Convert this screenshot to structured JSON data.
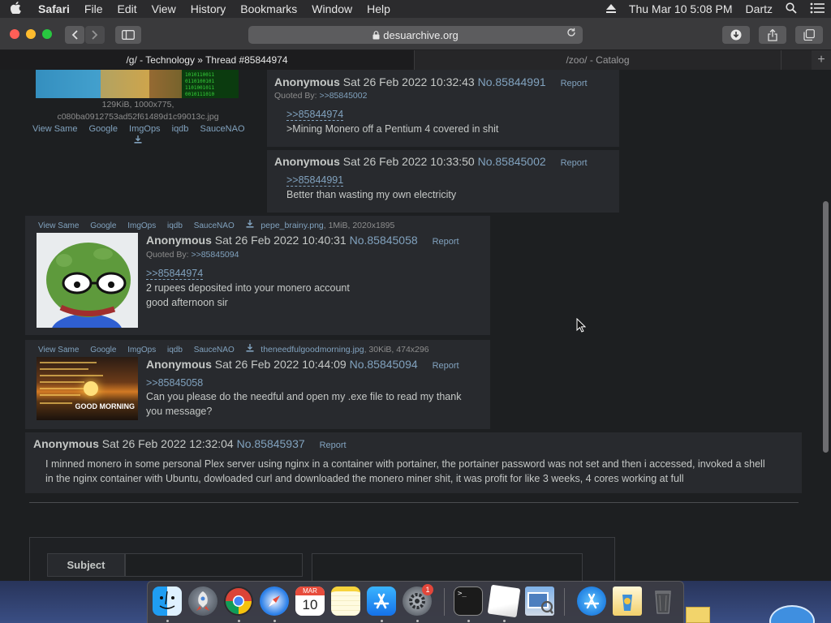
{
  "menubar": {
    "apple": "",
    "app": "Safari",
    "items": [
      "File",
      "Edit",
      "View",
      "History",
      "Bookmarks",
      "Window",
      "Help"
    ],
    "clock": "Thu Mar 10  5:08 PM",
    "user": "Dartz"
  },
  "browser": {
    "url": "desuarchive.org",
    "tabs": [
      {
        "title": "/g/ - Technology » Thread #85844974"
      },
      {
        "title": "/zoo/ - Catalog"
      }
    ]
  },
  "top_image": {
    "meta": "129KiB, 1000x775,",
    "filename": "c080ba0912753ad52f61489d1c99013c.jpg",
    "tools": [
      "View Same",
      "Google",
      "ImgOps",
      "iqdb",
      "SauceNAO"
    ]
  },
  "posts": [
    {
      "name": "Anonymous",
      "date": "Sat 26 Feb 2022 10:32:43",
      "num": "No.85844991",
      "report": "Report",
      "quoted_prefix": "Quoted By:",
      "quoted_by": ">>85845002",
      "quotelink": ">>85844974",
      "greentext": ">Mining Monero off a Pentium 4 covered in shit"
    },
    {
      "name": "Anonymous",
      "date": "Sat 26 Feb 2022 10:33:50",
      "num": "No.85845002",
      "report": "Report",
      "quotelink": ">>85844991",
      "body": "Better than wasting my own electricity"
    },
    {
      "tools": [
        "View Same",
        "Google",
        "ImgOps",
        "iqdb",
        "SauceNAO"
      ],
      "filename": "pepe_brainy.png",
      "filemeta": ", 1MiB, 2020x1895",
      "name": "Anonymous",
      "date": "Sat 26 Feb 2022 10:40:31",
      "num": "No.85845058",
      "report": "Report",
      "quoted_prefix": "Quoted By:",
      "quoted_by": ">>85845094",
      "quotelink": ">>85844974",
      "body_line1": "2 rupees deposited into your monero account",
      "body_line2": "good afternoon sir"
    },
    {
      "tools": [
        "View Same",
        "Google",
        "ImgOps",
        "iqdb",
        "SauceNAO"
      ],
      "filename": "theneedfulgoodmorning.jpg",
      "filemeta": ", 30KiB, 474x296",
      "thumb_text": "GOOD MORNING",
      "name": "Anonymous",
      "date": "Sat 26 Feb 2022 10:44:09",
      "num": "No.85845094",
      "report": "Report",
      "quotelink": ">>85845058",
      "body_line1": "Can you please do the needful and open my .exe file to read my thank",
      "body_line2": "you message?"
    },
    {
      "name": "Anonymous",
      "date": "Sat 26 Feb 2022 12:32:04",
      "num": "No.85845937",
      "report": "Report",
      "body_line1": "I minned monero in some personal Plex server using nginx in a container with portainer, the portainer password was not set and then i accessed, invoked a shell",
      "body_line2": "in the nginx container with Ubuntu, dowloaded curl and downloaded the monero miner shit, it was profit for like 3 weeks, 4 cores working at full"
    }
  ],
  "form": {
    "subject_label": "Subject"
  },
  "dock": {
    "calendar_month": "MAR",
    "calendar_day": "10",
    "badge": "1",
    "terminal_prompt": ">_"
  },
  "colors": {
    "link": "#81a2be",
    "greentext": "#b5bd68",
    "post_bg": "#282a2e",
    "page_bg": "#1d1f21"
  }
}
